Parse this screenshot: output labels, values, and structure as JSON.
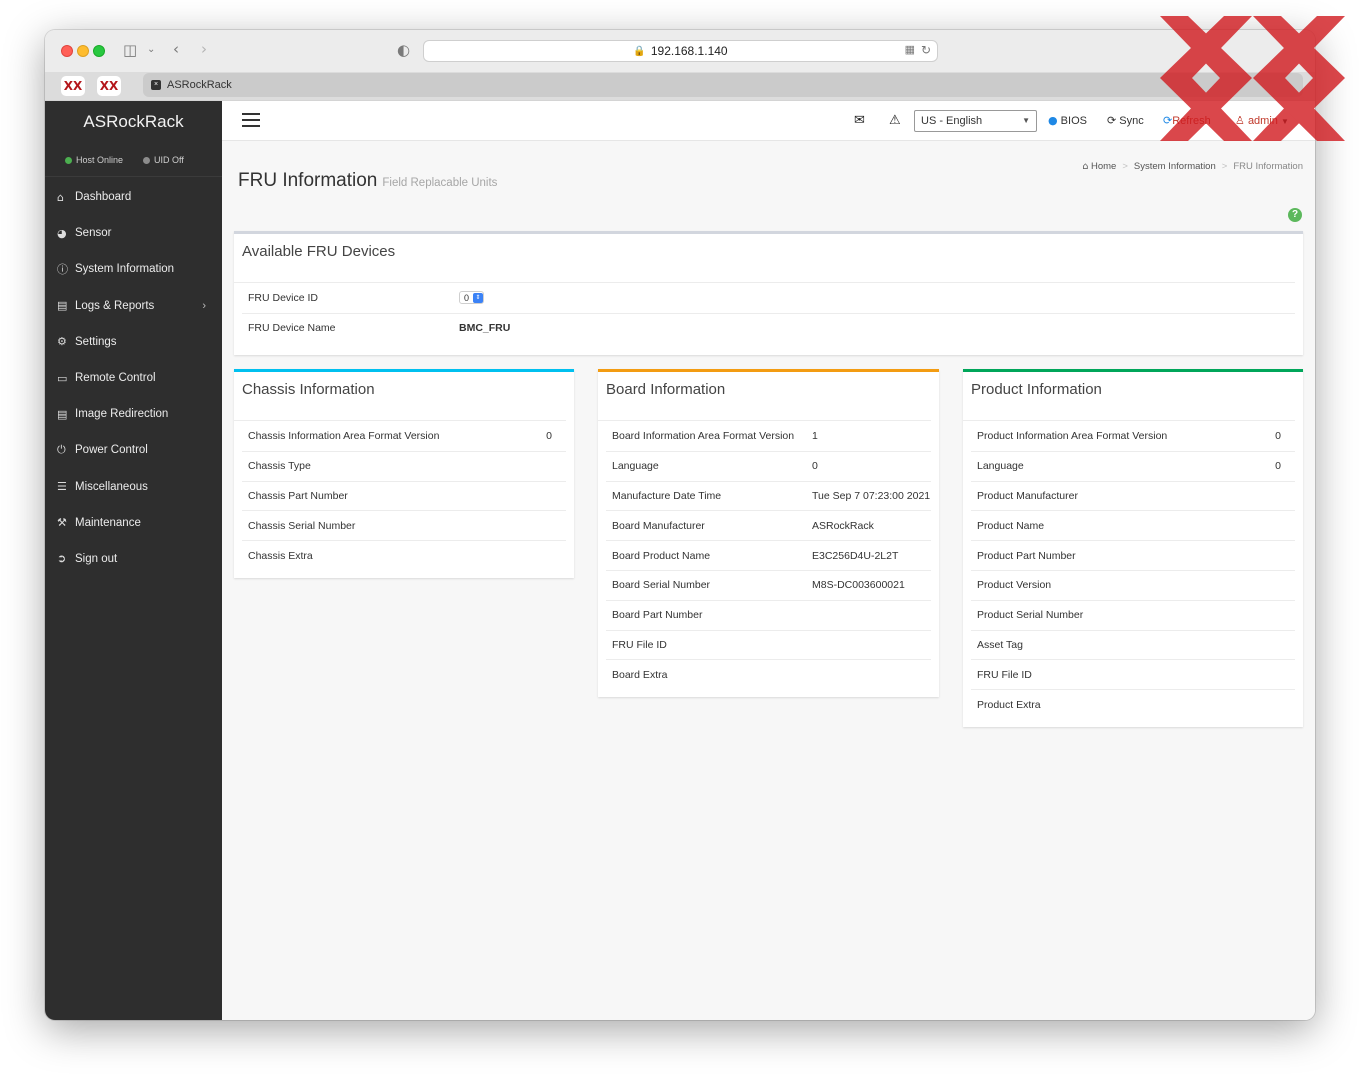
{
  "browser": {
    "url": "192.168.1.140",
    "tab_title": "ASRockRack",
    "pinned_tabs": [
      "XX",
      "XX"
    ]
  },
  "sidebar": {
    "brand": "ASRockRack",
    "status": [
      {
        "label": "Host Online",
        "color": "#4caf50"
      },
      {
        "label": "UID Off",
        "color": "#8c8c8c"
      }
    ],
    "items": [
      {
        "label": "Dashboard",
        "icon": "home-icon"
      },
      {
        "label": "Sensor",
        "icon": "dashboard-gauge-icon"
      },
      {
        "label": "System Information",
        "icon": "info-circle-icon"
      },
      {
        "label": "Logs & Reports",
        "icon": "bar-chart-icon",
        "has_submenu": true
      },
      {
        "label": "Settings",
        "icon": "gear-icon"
      },
      {
        "label": "Remote Control",
        "icon": "monitor-icon"
      },
      {
        "label": "Image Redirection",
        "icon": "drive-icon"
      },
      {
        "label": "Power Control",
        "icon": "power-icon"
      },
      {
        "label": "Miscellaneous",
        "icon": "list-icon"
      },
      {
        "label": "Maintenance",
        "icon": "wrench-icon"
      },
      {
        "label": "Sign out",
        "icon": "sign-out-icon"
      }
    ]
  },
  "topbar": {
    "language": "US - English",
    "bios_label": "BIOS",
    "sync_label": "Sync",
    "refresh_label": "Refresh",
    "user_label": "admin"
  },
  "page": {
    "title": "FRU Information",
    "subtitle": "Field Replacable Units",
    "breadcrumb": [
      "Home",
      "System Information",
      "FRU Information"
    ]
  },
  "fru_devices": {
    "title": "Available FRU Devices",
    "device_id_label": "FRU Device ID",
    "device_id_value": "0",
    "device_name_label": "FRU Device Name",
    "device_name_value": "BMC_FRU"
  },
  "chassis": {
    "title": "Chassis Information",
    "accent": "#00c0ef",
    "rows": [
      {
        "label": "Chassis Information Area Format Version",
        "value": "0"
      },
      {
        "label": "Chassis Type",
        "value": ""
      },
      {
        "label": "Chassis Part Number",
        "value": ""
      },
      {
        "label": "Chassis Serial Number",
        "value": ""
      },
      {
        "label": "Chassis Extra",
        "value": ""
      }
    ]
  },
  "board": {
    "title": "Board Information",
    "accent": "#f39c12",
    "rows": [
      {
        "label": "Board Information Area Format Version",
        "value": "1"
      },
      {
        "label": "Language",
        "value": "0"
      },
      {
        "label": "Manufacture Date Time",
        "value": "Tue Sep 7 07:23:00 2021"
      },
      {
        "label": "Board Manufacturer",
        "value": "ASRockRack"
      },
      {
        "label": "Board Product Name",
        "value": "E3C256D4U-2L2T"
      },
      {
        "label": "Board Serial Number",
        "value": "M8S-DC003600021"
      },
      {
        "label": "Board Part Number",
        "value": ""
      },
      {
        "label": "FRU File ID",
        "value": ""
      },
      {
        "label": "Board Extra",
        "value": ""
      }
    ]
  },
  "product": {
    "title": "Product Information",
    "accent": "#00a65a",
    "rows": [
      {
        "label": "Product Information Area Format Version",
        "value": "0"
      },
      {
        "label": "Language",
        "value": "0"
      },
      {
        "label": "Product Manufacturer",
        "value": ""
      },
      {
        "label": "Product Name",
        "value": ""
      },
      {
        "label": "Product Part Number",
        "value": ""
      },
      {
        "label": "Product Version",
        "value": ""
      },
      {
        "label": "Product Serial Number",
        "value": ""
      },
      {
        "label": "Asset Tag",
        "value": ""
      },
      {
        "label": "FRU File ID",
        "value": ""
      },
      {
        "label": "Product Extra",
        "value": ""
      }
    ]
  }
}
